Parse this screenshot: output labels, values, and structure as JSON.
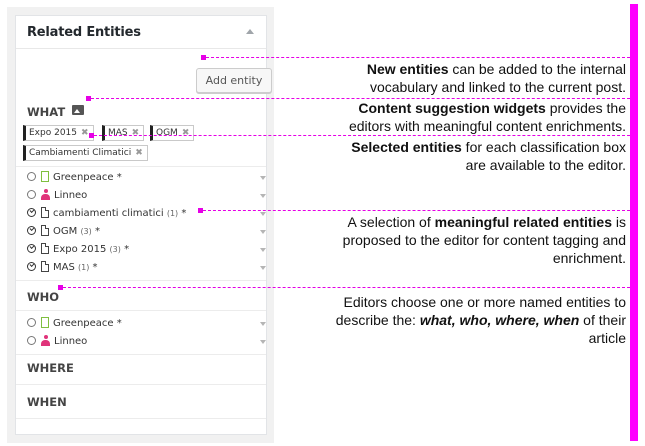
{
  "panel": {
    "title": "Related Entities",
    "add_entity_label": "Add entity",
    "sections": {
      "what": "WHAT",
      "who": "WHO",
      "where": "WHERE",
      "when": "WHEN"
    },
    "selected_tags": [
      "Expo 2015",
      "MAS",
      "OGM",
      "Cambiamenti Climatici"
    ],
    "tag_remove_glyph": "✖",
    "what_entities": [
      {
        "icon": "organization-icon",
        "name": "Greenpeace",
        "count": "",
        "star": "*",
        "checked": false
      },
      {
        "icon": "person-icon",
        "name": "Linneo",
        "count": "",
        "star": "",
        "checked": false
      },
      {
        "icon": "document-icon",
        "name": "cambiamenti climatici",
        "count": "(1)",
        "star": "*",
        "checked": true
      },
      {
        "icon": "document-icon",
        "name": "OGM",
        "count": "(3)",
        "star": "*",
        "checked": true
      },
      {
        "icon": "document-icon",
        "name": "Expo 2015",
        "count": "(3)",
        "star": "*",
        "checked": true
      },
      {
        "icon": "document-icon",
        "name": "MAS",
        "count": "(1)",
        "star": "*",
        "checked": true
      }
    ],
    "who_entities": [
      {
        "icon": "organization-icon",
        "name": "Greenpeace",
        "count": "",
        "star": "*",
        "checked": false
      },
      {
        "icon": "person-icon",
        "name": "Linneo",
        "count": "",
        "star": "",
        "checked": false
      }
    ]
  },
  "annotations": {
    "new_entities": {
      "bold": "New entities",
      "line1_rest": " can be added to the internal",
      "line2": "vocabulary and linked to the current post."
    },
    "suggestion": {
      "bold": "Content suggestion widgets",
      "line1_rest": " provides the",
      "line2": "editors with meaningful content enrichments."
    },
    "selected": {
      "bold": "Selected entities",
      "line1_rest": " for each classification box",
      "line2": "are available to the editor."
    },
    "related": {
      "line1_pre": "A selection of ",
      "bold": "meaningful related entities",
      "line1_rest": " is",
      "line2": "proposed to the editor for content tagging and",
      "line3": "enrichment."
    },
    "editors": {
      "line1": "Editors choose one or more named entities to",
      "line2_pre": "describe the: ",
      "line2_bold": "what, who, where, when",
      "line2_rest": " of their",
      "line3": "article"
    }
  },
  "colors": {
    "accent_magenta": "#ff00ff",
    "organization_green": "#7fbf3f",
    "person_pink": "#e0337a"
  }
}
